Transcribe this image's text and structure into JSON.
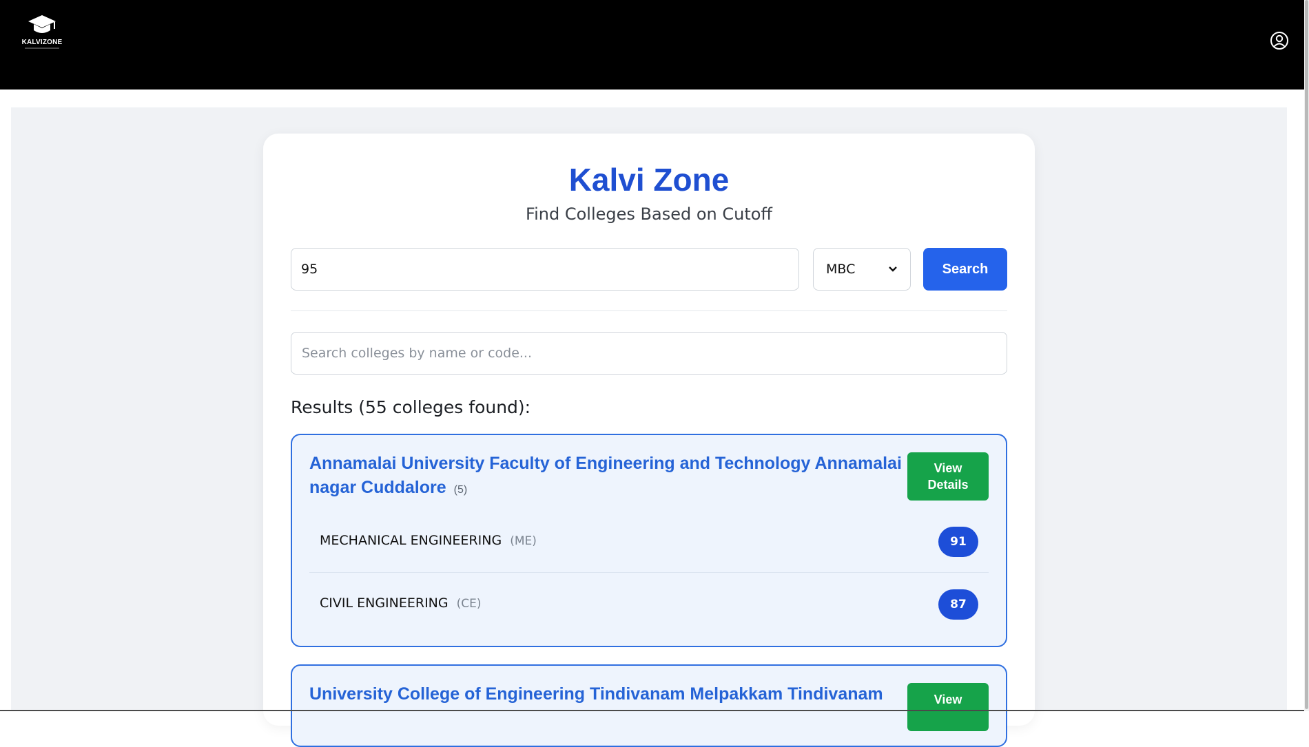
{
  "header": {
    "logo_text": "KALVIZONE",
    "user_icon": "user-circle-icon"
  },
  "main": {
    "title": "Kalvi Zone",
    "subtitle": "Find Colleges Based on Cutoff",
    "cutoff_value": "95",
    "category_selected": "MBC",
    "search_label": "Search",
    "college_search_placeholder": "Search colleges by name or code...",
    "results_heading": "Results (55 colleges found):"
  },
  "colleges": [
    {
      "name": "Annamalai University Faculty of Engineering and Technology Annamalai nagar Cuddalore",
      "code": "(5)",
      "view_label_1": "View",
      "view_label_2": "Details",
      "courses": [
        {
          "name": "MECHANICAL ENGINEERING",
          "code": "(ME)",
          "cutoff": "91"
        },
        {
          "name": "CIVIL ENGINEERING",
          "code": "(CE)",
          "cutoff": "87"
        }
      ]
    },
    {
      "name": "University College of Engineering Tindivanam Melpakkam Tindivanam",
      "view_label_1": "View"
    }
  ],
  "colors": {
    "accent": "#2563eb",
    "title": "#1f4fd1",
    "view_button": "#16a34a",
    "badge": "#1d4ed8"
  }
}
